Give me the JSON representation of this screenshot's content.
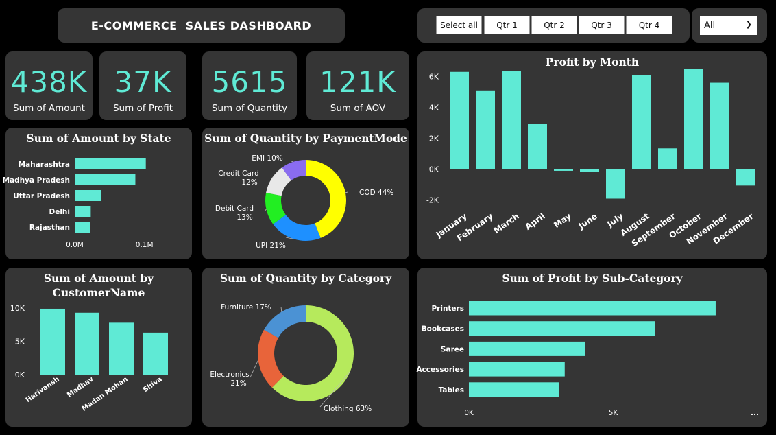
{
  "header": {
    "title": "E-COMMERCE  SALES DASHBOARD"
  },
  "slicer": {
    "buttons": [
      "Select all",
      "Qtr 1",
      "Qtr 2",
      "Qtr 3",
      "Qtr 4"
    ],
    "dropdown_value": "All"
  },
  "kpis": [
    {
      "value": "438K",
      "label": "Sum of Amount"
    },
    {
      "value": "37K",
      "label": "Sum of Profit"
    },
    {
      "value": "5615",
      "label": "Sum of Quantity"
    },
    {
      "value": "121K",
      "label": "Sum of AOV"
    }
  ],
  "colors": {
    "accent": "#5fead5",
    "panel": "#353535",
    "background": "#000000"
  },
  "chart_data": [
    {
      "id": "state",
      "type": "bar",
      "orientation": "horizontal",
      "title": "Sum of Amount by State",
      "categories": [
        "Maharashtra",
        "Madhya Pradesh",
        "Uttar Pradesh",
        "Delhi",
        "Rajasthan"
      ],
      "values": [
        0.102,
        0.087,
        0.038,
        0.023,
        0.022
      ],
      "ticks": [
        {
          "v": 0,
          "label": "0.0M"
        },
        {
          "v": 0.1,
          "label": "0.1M"
        }
      ],
      "xlim": [
        0,
        0.12
      ]
    },
    {
      "id": "payment",
      "type": "pie",
      "donut": true,
      "title": "Sum of Quantity by PaymentMode",
      "slices": [
        {
          "name": "COD",
          "value": 44,
          "label": "COD 44%",
          "color": "#ffff00"
        },
        {
          "name": "UPI",
          "value": 21,
          "label": "UPI 21%",
          "color": "#1e90ff"
        },
        {
          "name": "Debit Card",
          "value": 13,
          "label1": "Debit Card",
          "label2": "13%",
          "color": "#22ee22"
        },
        {
          "name": "Credit Card",
          "value": 12,
          "label1": "Credit Card",
          "label2": "12%",
          "color": "#e8e8e8"
        },
        {
          "name": "EMI",
          "value": 10,
          "label": "EMI 10%",
          "color": "#8a6cf0"
        }
      ]
    },
    {
      "id": "month",
      "type": "bar",
      "title": "Profit by Month",
      "categories": [
        "January",
        "February",
        "March",
        "April",
        "May",
        "June",
        "July",
        "August",
        "September",
        "October",
        "November",
        "December"
      ],
      "values": [
        6300,
        5100,
        6350,
        2950,
        -100,
        -150,
        -1900,
        6100,
        1350,
        6500,
        5600,
        -1050
      ],
      "ticks": [
        {
          "v": 6000,
          "label": "6K"
        },
        {
          "v": 4000,
          "label": "4K"
        },
        {
          "v": 2000,
          "label": "2K"
        },
        {
          "v": 0,
          "label": "0K"
        },
        {
          "v": -2000,
          "label": "-2K"
        }
      ],
      "ylim": [
        -2500,
        7000
      ]
    },
    {
      "id": "customer",
      "type": "bar",
      "title": "Sum of Amount by CustomerName",
      "categories": [
        "Harivansh",
        "Madhav",
        "Madan Mohan",
        "Shiva"
      ],
      "values": [
        9900,
        9300,
        7800,
        6300
      ],
      "ticks": [
        {
          "v": 10000,
          "label": "10K"
        },
        {
          "v": 5000,
          "label": "5K"
        },
        {
          "v": 0,
          "label": "0K"
        }
      ],
      "ylim": [
        0,
        10000
      ]
    },
    {
      "id": "category",
      "type": "pie",
      "donut": true,
      "title": "Sum of Quantity by Category",
      "slices": [
        {
          "name": "Clothing",
          "value": 63,
          "label": "Clothing 63%",
          "color": "#b6ea5c"
        },
        {
          "name": "Electronics",
          "value": 21,
          "label1": "Electronics",
          "label2": "21%",
          "color": "#e8643a"
        },
        {
          "name": "Furniture",
          "value": 17,
          "label": "Furniture 17%",
          "color": "#4b92d4"
        }
      ]
    },
    {
      "id": "subcategory",
      "type": "bar",
      "orientation": "horizontal",
      "title": "Sum of Profit by Sub-Category",
      "categories": [
        "Printers",
        "Bookcases",
        "Saree",
        "Accessories",
        "Tables"
      ],
      "values": [
        8550,
        6450,
        4020,
        3320,
        3130
      ],
      "ticks": [
        {
          "v": 0,
          "label": "0K"
        },
        {
          "v": 5000,
          "label": "5K"
        }
      ],
      "xlim": [
        0,
        10000
      ],
      "more_label": "..."
    }
  ]
}
